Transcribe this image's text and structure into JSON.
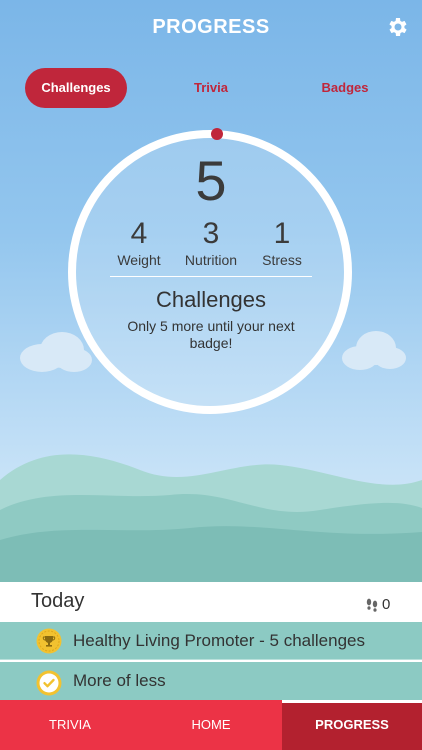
{
  "header": {
    "title": "PROGRESS",
    "settings_icon": "gear-icon"
  },
  "segments": [
    {
      "label": "Challenges",
      "active": true
    },
    {
      "label": "Trivia",
      "active": false
    },
    {
      "label": "Badges",
      "active": false
    }
  ],
  "summary": {
    "total": "5",
    "stats": [
      {
        "value": "4",
        "label": "Weight"
      },
      {
        "value": "3",
        "label": "Nutrition"
      },
      {
        "value": "1",
        "label": "Stress"
      }
    ],
    "title": "Challenges",
    "subtitle": "Only 5 more until your next badge!"
  },
  "today": {
    "label": "Today",
    "steps": "0",
    "steps_icon": "footsteps-icon"
  },
  "entries": [
    {
      "text": "Healthy Living Promoter - 5 challenges",
      "icon": "trophy-icon"
    },
    {
      "text": "More of less",
      "icon": "checkmark-icon"
    }
  ],
  "tabs": [
    {
      "label": "TRIVIA",
      "active": false
    },
    {
      "label": "HOME",
      "active": false
    },
    {
      "label": "PROGRESS",
      "active": true
    }
  ],
  "colors": {
    "accent": "#c0263b",
    "tabbar": "#ec3346",
    "row": "#8ccac3",
    "sky": "#93c6ee"
  }
}
